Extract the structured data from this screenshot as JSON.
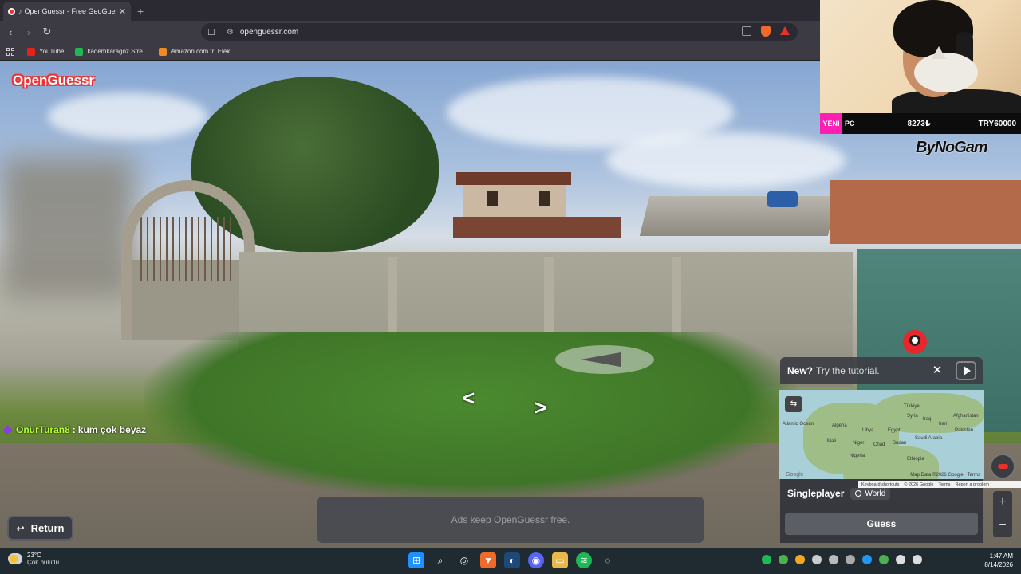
{
  "browser": {
    "tab_title": "OpenGuessr - Free GeoGuess",
    "tab_close": "✕",
    "new_tab": "+",
    "back": "‹",
    "forward": "›",
    "reload": "↻",
    "url": "openguessr.com",
    "bookmarks": [
      {
        "label": "YouTube",
        "color": "#e62117"
      },
      {
        "label": "kademkaragoz Stre...",
        "color": "#1db954"
      },
      {
        "label": "Amazon.com.tr: Elek...",
        "color": "#f08a24"
      }
    ]
  },
  "stream_overlay": {
    "ticker_tag": "YENİ",
    "ticker_label": "PC",
    "ticker_value_1": "8273₺",
    "ticker_value_2": "TRY60000",
    "brand_a": "ByNo",
    "brand_b": "Gam"
  },
  "game": {
    "logo": "OpenGuessr",
    "chat": {
      "user": "OnurTuran8",
      "separator": ":",
      "message": "kum çok beyaz"
    },
    "return_label": "Return",
    "return_arrow": "↩",
    "ads_text": "Ads keep OpenGuessr free.",
    "tutorial": {
      "new_label": "New?",
      "text": "Try the tutorial.",
      "close": "✕"
    },
    "minimap": {
      "labels": [
        "Türkiye",
        "Syria",
        "Iraq",
        "Afghanistan",
        "Iran",
        "Algeria",
        "Libya",
        "Egypt",
        "Pakistan",
        "Saudi Arabia",
        "Mali",
        "Niger",
        "Chad",
        "Sudan",
        "Nigeria",
        "Ethiopia",
        "Atlantic Ocean"
      ],
      "attribution": "Map Data ©2026 Google",
      "terms": "Terms",
      "google": "Google"
    },
    "mode": "Singleplayer",
    "region": "World",
    "guess_label": "Guess",
    "zoom_in": "+",
    "zoom_out": "−",
    "map_footer": [
      "Keyboard shortcuts",
      "© 2026 Google",
      "Terms",
      "Report a problem"
    ]
  },
  "taskbar": {
    "temperature": "23°C",
    "condition": "Çok bulutlu",
    "time": "1:47 AM",
    "date": "8/14/2026"
  }
}
